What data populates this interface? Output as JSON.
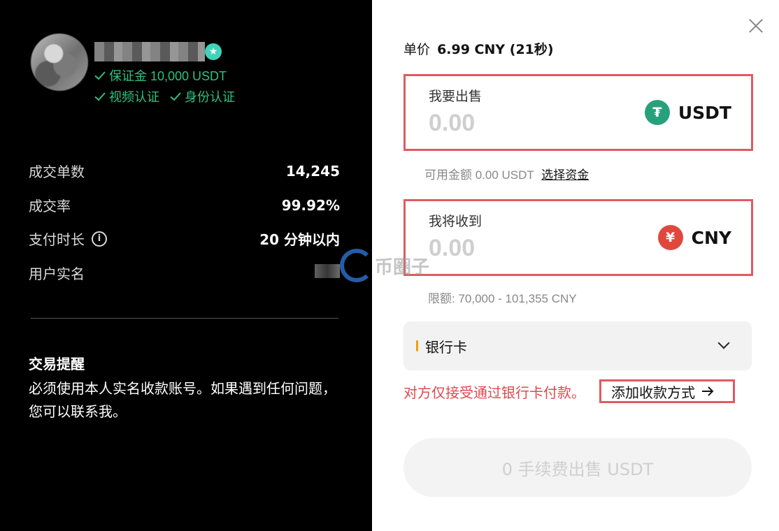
{
  "seller": {
    "deposit_badge": "保证金 10,000 USDT",
    "video_verified": "视频认证",
    "id_verified": "身份认证"
  },
  "stats": [
    {
      "label": "成交单数",
      "value": "14,245"
    },
    {
      "label": "成交率",
      "value": "99.92%"
    },
    {
      "label": "支付时长",
      "value": "20 分钟以内"
    },
    {
      "label": "用户实名",
      "value": ""
    }
  ],
  "reminder": {
    "title": "交易提醒",
    "text": "必须使用本人实名收款账号。如果遇到任何问题，您可以联系我。"
  },
  "watermark": "币圈子",
  "order": {
    "price_label": "单价",
    "price_value": "6.99 CNY (21秒)",
    "sell_label": "我要出售",
    "sell_placeholder": "0.00",
    "sell_currency": "USDT",
    "available_label": "可用金额 0.00 USDT",
    "select_funds": "选择资金",
    "receive_label": "我将收到",
    "receive_placeholder": "0.00",
    "receive_currency": "CNY",
    "limit_text": "限额: 70,000 - 101,355 CNY",
    "payment_method": "银行卡",
    "warning": "对方仅接受通过银行卡付款。",
    "add_payment": "添加收款方式",
    "submit": "0 手续费出售 USDT"
  },
  "icons": {
    "usdt_coin": "tether-icon",
    "cny_coin": "yuan-icon",
    "close": "close-icon",
    "info": "info-icon",
    "verified": "verified-star-icon",
    "check": "check-icon",
    "chevron": "chevron-down-icon",
    "arrow": "arrow-right-icon"
  },
  "colors": {
    "accent_green": "#2ec27e",
    "highlight_red": "#e05a5f",
    "usdt_green": "#26a17b",
    "cny_red": "#e0483e"
  }
}
